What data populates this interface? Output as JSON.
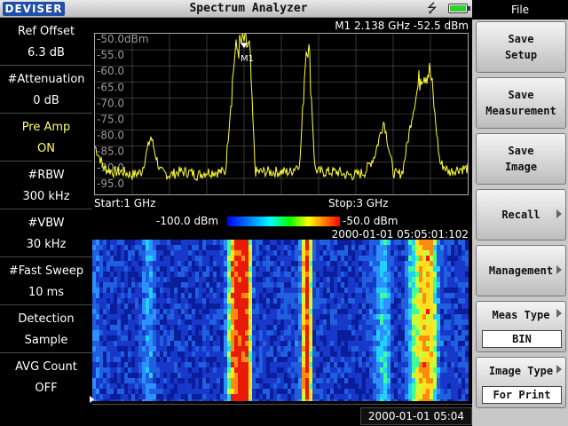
{
  "header": {
    "logo_text": "DEVISER",
    "title": "Spectrum Analyzer",
    "usb_icon": "usb-icon",
    "battery_icon": "battery-icon",
    "battery_color": "#33cc33"
  },
  "params": [
    {
      "label": "Ref Offset",
      "value": "6.3 dB",
      "active": false
    },
    {
      "label": "#Attenuation",
      "value": "0 dB",
      "active": false
    },
    {
      "label": "Pre Amp",
      "value": "ON",
      "active": true
    },
    {
      "label": "#RBW",
      "value": "300 kHz",
      "active": false
    },
    {
      "label": "#VBW",
      "value": "30 kHz",
      "active": false
    },
    {
      "label": "#Fast Sweep",
      "value": "10 ms",
      "active": false
    },
    {
      "label": "Detection",
      "value": "Sample",
      "active": false
    },
    {
      "label": "AVG Count",
      "value": "OFF",
      "active": false
    }
  ],
  "spectrum": {
    "marker_readout": "M1 2.138 GHz -52.5 dBm",
    "marker_label": "M1",
    "start": "Start:1 GHz",
    "stop": "Stop:3 GHz",
    "trace_color": "#ffff33"
  },
  "waterfall": {
    "scale_min": "-100.0 dBm",
    "scale_max": "-50.0 dBm",
    "timestamp": "2000-01-01 05:05:01:102"
  },
  "status": {
    "time": "2000-01-01 05:04"
  },
  "menu": {
    "title": "File",
    "keys": [
      {
        "line1": "Save",
        "line2": "Setup"
      },
      {
        "line1": "Save",
        "line2": "Measurement"
      },
      {
        "line1": "Save",
        "line2": "Image"
      },
      {
        "line1": "Recall"
      },
      {
        "line1": "Management"
      },
      {
        "line1": "Meas Type",
        "value": "BIN"
      },
      {
        "line1": "Image Type",
        "value": "For Print"
      }
    ]
  },
  "chart_data": {
    "type": "line",
    "title": "",
    "xlabel": "",
    "ylabel": "",
    "x_range_ghz": [
      1,
      3
    ],
    "y_tick_labels": [
      "-50.0dBm",
      "-55.0",
      "-60.0",
      "-65.0",
      "-70.0",
      "-75.0",
      "-80.0",
      "-85.0",
      "-90.0",
      "-95.0"
    ],
    "ylim": [
      -100,
      -50
    ],
    "grid": true,
    "series": [
      {
        "x": [
          1.0,
          1.05,
          1.1,
          1.15,
          1.2,
          1.25,
          1.3,
          1.35,
          1.4,
          1.45,
          1.5,
          1.55,
          1.6,
          1.65,
          1.7,
          1.75,
          1.8,
          1.83,
          1.86,
          1.9,
          1.95,
          2.0,
          2.05,
          2.1,
          2.13,
          2.138,
          2.15,
          2.18,
          2.2,
          2.25,
          2.3,
          2.35,
          2.4,
          2.45,
          2.5,
          2.55,
          2.6,
          2.62,
          2.65,
          2.7,
          2.75,
          2.8,
          2.85,
          2.9,
          2.95,
          3.0
        ],
        "y": [
          -85,
          -92,
          -93,
          -93,
          -94,
          -93,
          -82,
          -93,
          -94,
          -93,
          -93,
          -94,
          -93,
          -93,
          -93,
          -56,
          -52,
          -55,
          -93,
          -93,
          -93,
          -93,
          -93,
          -90,
          -56,
          -52.5,
          -56,
          -92,
          -93,
          -93,
          -93,
          -94,
          -94,
          -93,
          -88,
          -77,
          -93,
          -94,
          -93,
          -76,
          -62,
          -62,
          -90,
          -93,
          -92,
          -92
        ]
      }
    ]
  }
}
